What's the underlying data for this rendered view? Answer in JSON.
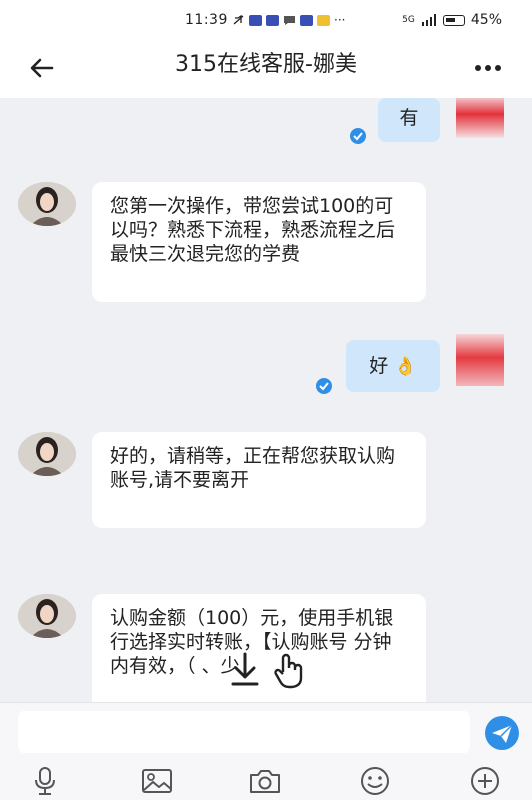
{
  "status": {
    "time": "11:39",
    "network": "5G",
    "battery": "45%"
  },
  "header": {
    "title": "315在线客服-娜美"
  },
  "messages": [
    {
      "dir": "out",
      "text": "有"
    },
    {
      "dir": "in",
      "text": "您第一次操作，带您尝试100的可以吗？熟悉下流程，熟悉流程之后最快三次退完您的学费"
    },
    {
      "dir": "out",
      "text": "好",
      "emoji": "👌"
    },
    {
      "dir": "in",
      "text": "好的，请稍等，正在帮您获取认购账号,请不要离开"
    },
    {
      "dir": "in",
      "text": "认购金额（100）元，使用手机银行选择实时转账，【认购账号  分钟内有效，（   、少"
    }
  ],
  "colors": {
    "accent": "#2f8fe6",
    "bubble_out": "#cfe6fb",
    "bubble_in": "#ffffff",
    "bg": "#eef0f4"
  },
  "input": {
    "value": "",
    "placeholder": ""
  },
  "toolbar": {
    "icons": [
      "microphone-icon",
      "image-icon",
      "camera-icon",
      "emoji-icon",
      "plus-icon"
    ]
  }
}
